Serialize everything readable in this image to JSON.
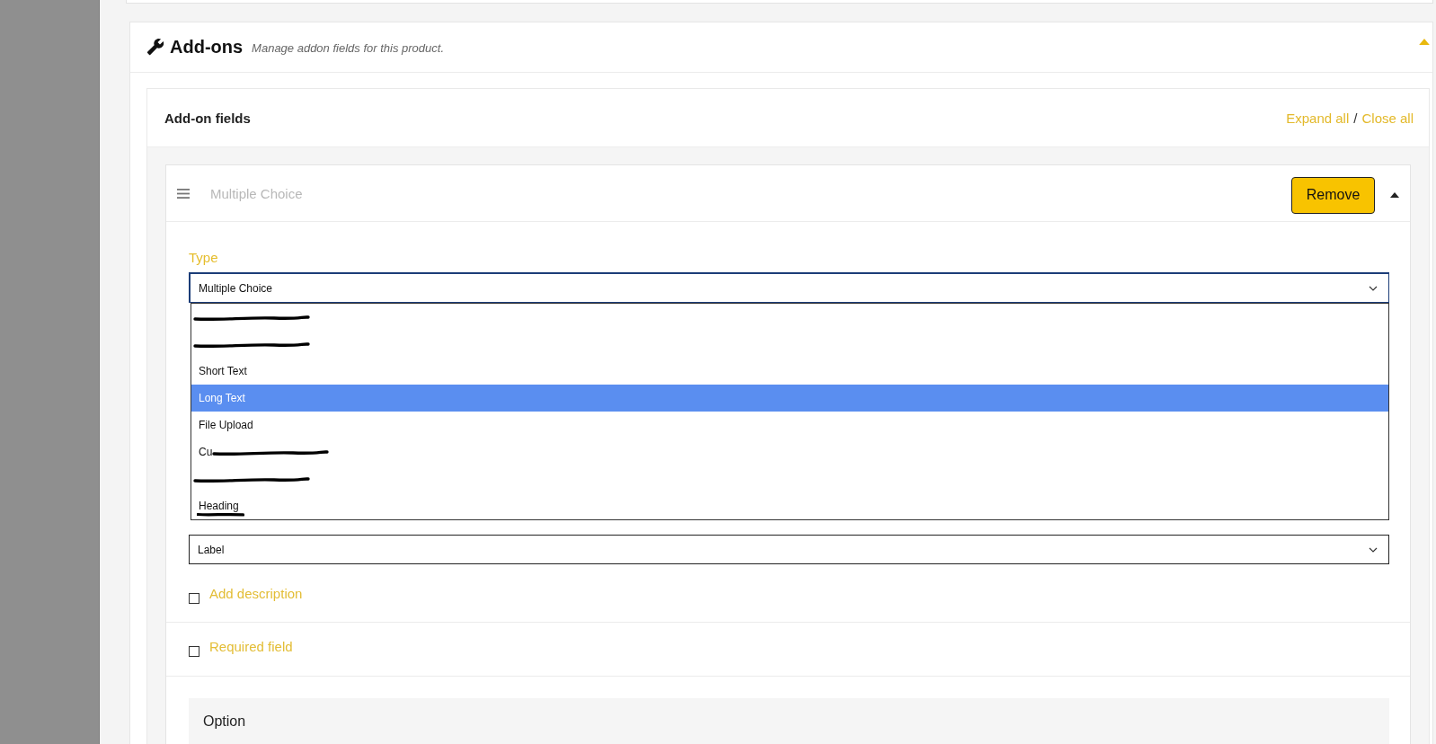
{
  "section": {
    "title": "Add-ons",
    "description": "Manage addon fields for this product.",
    "expanded": true
  },
  "fields_panel": {
    "title": "Add-on fields",
    "expand_all": "Expand all",
    "separator": "/",
    "close_all": "Close all"
  },
  "addon": {
    "name": "Multiple Choice",
    "remove_button": "Remove",
    "expanded": true,
    "type_field": {
      "label": "Type",
      "value": "Multiple Choice",
      "open": true,
      "options": [
        {
          "kind": "scribbled",
          "selected": false
        },
        {
          "kind": "scribbled",
          "selected": false
        },
        {
          "kind": "plain",
          "label": "Short Text",
          "selected": false
        },
        {
          "kind": "plain",
          "label": "Long Text",
          "selected": true
        },
        {
          "kind": "plain",
          "label": "File Upload",
          "selected": false
        },
        {
          "kind": "scribbled",
          "label": "Cu",
          "selected": false
        },
        {
          "kind": "scribbled",
          "selected": false
        },
        {
          "kind": "underscored",
          "label": "Heading",
          "selected": false
        }
      ]
    },
    "title_format_field": {
      "value": "Label"
    },
    "description_checkbox": {
      "label": "Add description",
      "checked": false
    },
    "required_checkbox": {
      "label": "Required field",
      "checked": false
    },
    "options_section": {
      "title": "Option"
    }
  }
}
